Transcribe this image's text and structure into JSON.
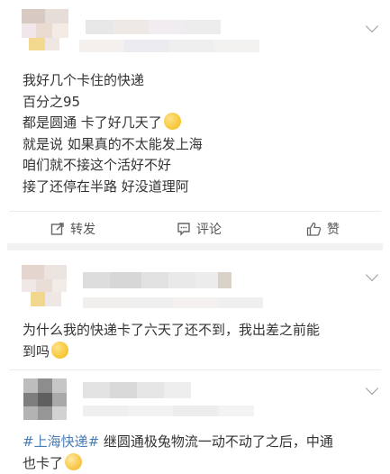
{
  "comments": [
    {
      "lines": [
        "我好几个卡住的快递",
        "百分之95",
        "都是圆通  卡了好几天了",
        "就是说 如果真的不太能发上海",
        "咱们就不接这个活好不好",
        "接了还停在半路 好没道理阿"
      ],
      "emoji_icon": "blush-emoji-icon"
    },
    {
      "line1": "为什么我的快递卡了六天了还不到，我出差之前能",
      "line2": "到吗",
      "emoji_icon": "blush-emoji-icon"
    },
    {
      "hashtag": "#上海快递#",
      "line1_rest": " 继圆通极兔物流一动不动了之后，中通",
      "line2": "也卡了",
      "emoji_icon": "smile-emoji-icon"
    }
  ],
  "actions": {
    "repost": "转发",
    "comment": "评论",
    "like": "赞"
  }
}
